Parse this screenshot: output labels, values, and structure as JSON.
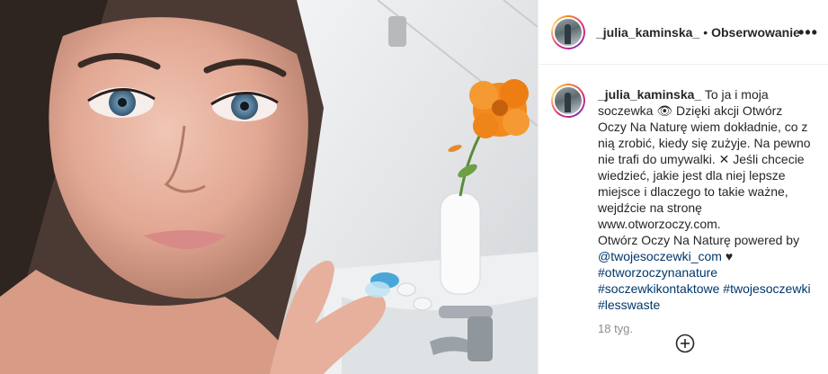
{
  "header": {
    "username": "_julia_kaminska_",
    "separator": "•",
    "follow_label": "Obserwowanie",
    "more_label": "•••"
  },
  "caption": {
    "username": "_julia_kaminska_",
    "text_1": "To ja i moja soczewka 👁 Dzięki akcji Otwórz Oczy Na Naturę wiem dokładnie, co z nią zrobić, kiedy się zużyje. Na pewno nie trafi do umywalki. ✕ Jeśli chcecie wiedzieć, jakie jest dla niej lepsze miejsce i dlaczego to takie ważne, wejdźcie na stronę www.otworzoczy.com.",
    "text_2": "Otwórz Oczy Na Naturę powered by",
    "mention": "@twojesoczewki_com",
    "heart": "♥",
    "tags": [
      "#otworzoczynanature",
      "#soczewkikontaktowe",
      "#twojesoczewki",
      "#lesswaste"
    ]
  },
  "timeago": "18 tyg.",
  "icons": {
    "add_comment": "plus-circle-icon",
    "more": "more-options-icon"
  },
  "colors": {
    "link": "#00376b",
    "muted": "#8e8e8e",
    "flower": "#f28a1f"
  }
}
